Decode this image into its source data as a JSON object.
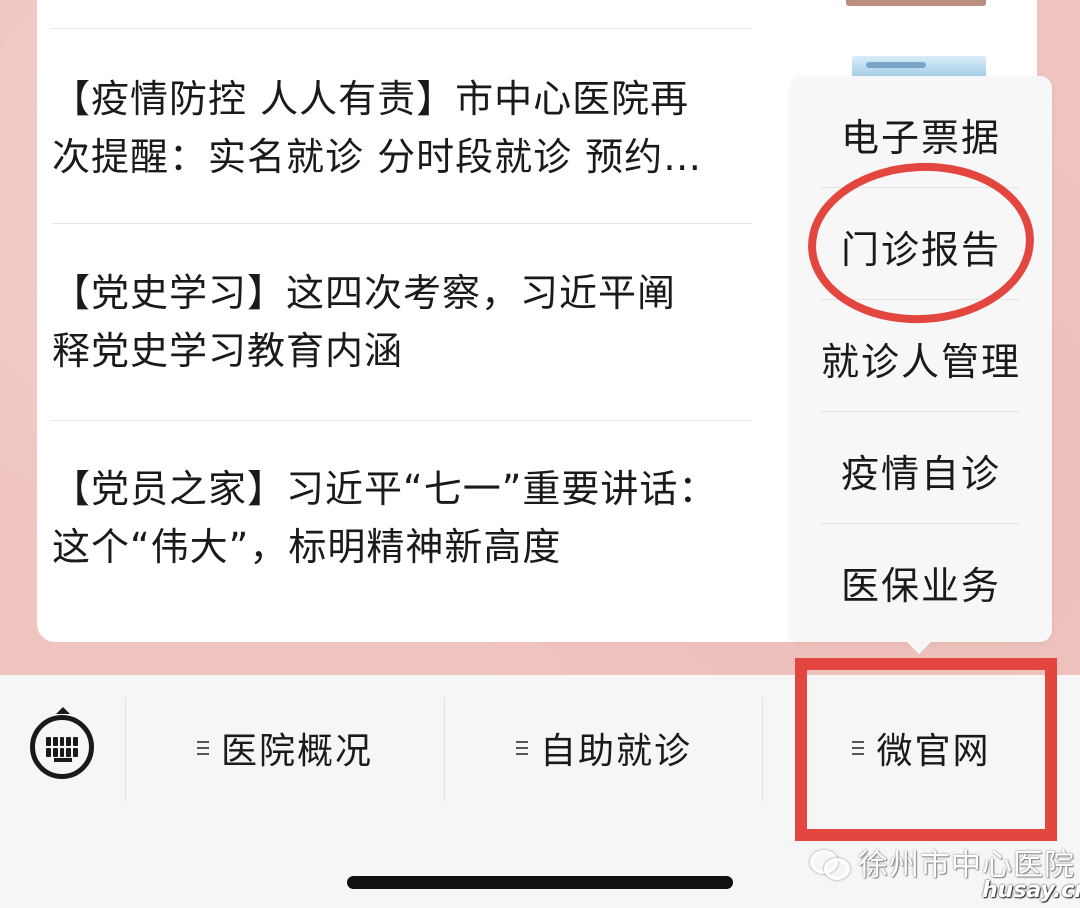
{
  "news": {
    "items": [
      {
        "line1": "【疫情防控 人人有责】市中心医院再",
        "line2": "次提醒：实名就诊 分时段就诊 预约…"
      },
      {
        "line1": "【党史学习】这四次考察，习近平阐",
        "line2": "释党史学习教育内涵"
      },
      {
        "line1": "【党员之家】习近平“七一”重要讲话：",
        "line2": "这个“伟大”，标明精神新高度"
      }
    ]
  },
  "popup_menu": {
    "items": [
      "电子票据",
      "门诊报告",
      "就诊人管理",
      "疫情自诊",
      "医保业务"
    ],
    "highlighted": "门诊报告"
  },
  "bottom_menu": {
    "items": [
      "医院概况",
      "自助就诊",
      "微官网"
    ],
    "highlighted": "微官网"
  },
  "watermark": {
    "account": "徐州市中心医院",
    "site": "husay.cn"
  },
  "colors": {
    "annotation_red": "#e3463f",
    "background_pink": "#f0c4bf"
  }
}
